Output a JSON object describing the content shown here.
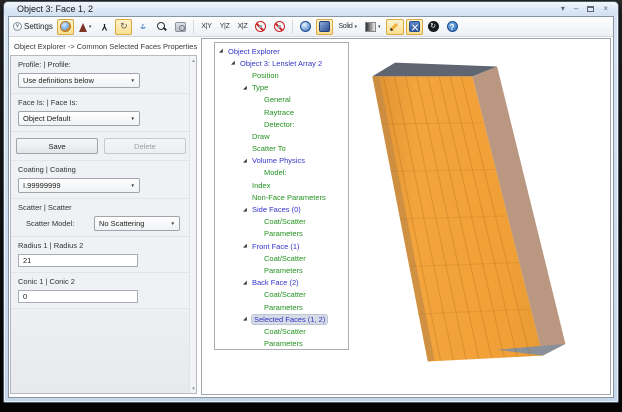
{
  "window": {
    "title": "Object 3: Face 1, 2"
  },
  "glyphs": {
    "settings_chevron": "∨",
    "window_menu": "▾",
    "minimize": "–",
    "close": "×",
    "dropdown_caret": "▾",
    "combo_arrow": "▼",
    "scroll_up": "▲",
    "scroll_down": "▼",
    "tree_expanded": "◢",
    "rotate": "↻",
    "reset": "↻",
    "axes": "Y",
    "pan_h": "↔",
    "pan_v": "↕",
    "help": "?"
  },
  "toolbar": {
    "settings": {
      "label": "Settings"
    },
    "buttons": [
      {
        "name": "shaded-model",
        "icon": "sphere-orange",
        "toggled": true
      },
      {
        "name": "view-orientation",
        "icon": "isometric-tree",
        "dropdown": true
      },
      {
        "name": "axes",
        "icon": "axes"
      },
      {
        "name": "rotate",
        "icon": "rotate-arrow",
        "toggled": true
      },
      {
        "name": "pan",
        "icon": "pan-arrows"
      },
      {
        "name": "zoom",
        "icon": "magnifier"
      },
      {
        "name": "zoom-window",
        "icon": "camera-frame"
      },
      {
        "type": "sep"
      },
      {
        "name": "view-xy",
        "label": "X|Y"
      },
      {
        "name": "view-yz",
        "label": "Y|Z"
      },
      {
        "name": "view-xz",
        "label": "X|Z"
      },
      {
        "name": "no-spin-1",
        "icon": "prohibit"
      },
      {
        "name": "no-spin-2",
        "icon": "prohibit"
      },
      {
        "type": "sep"
      },
      {
        "name": "globe",
        "icon": "globe-blue"
      },
      {
        "name": "cube",
        "icon": "cube-blue",
        "toggled": true
      },
      {
        "name": "solid-mode",
        "label": "Solid",
        "dropdown": true
      },
      {
        "name": "opacity",
        "icon": "gradient-square",
        "dropdown": true
      },
      {
        "name": "pen",
        "icon": "pen",
        "toggled": true
      },
      {
        "name": "fit-window",
        "icon": "fit-arrows",
        "toggled": true
      },
      {
        "name": "reset-view",
        "icon": "reset-circle"
      },
      {
        "name": "help",
        "icon": "help-circle"
      }
    ]
  },
  "breadcrumb": "Object Explorer ->  Common Selected Faces Properties",
  "properties_panel": {
    "sections": [
      {
        "name": "profile",
        "label": "Profile: | Profile:",
        "control": {
          "kind": "combo",
          "value": "Use definitions below"
        }
      },
      {
        "name": "face-is",
        "label": "Face Is: | Face Is:",
        "control": {
          "kind": "combo",
          "value": "Object Default"
        }
      },
      {
        "name": "actions",
        "kind": "buttons",
        "buttons": [
          {
            "label": "Save",
            "enabled": true
          },
          {
            "label": "Delete",
            "enabled": false
          }
        ]
      },
      {
        "name": "coating",
        "label": "Coating | Coating",
        "control": {
          "kind": "combo",
          "value": "I.99999999"
        }
      },
      {
        "name": "scatter",
        "label": "Scatter | Scatter",
        "control": {
          "kind": "inline-combo",
          "inline_label": "Scatter Model:",
          "value": "No Scattering"
        }
      },
      {
        "name": "radius",
        "label": "Radius 1 | Radius 2",
        "control": {
          "kind": "input",
          "value": "21"
        }
      },
      {
        "name": "conic",
        "label": "Conic 1 | Conic 2",
        "control": {
          "kind": "input",
          "value": "0"
        }
      }
    ]
  },
  "tree": {
    "items": [
      {
        "label": "Object Explorer",
        "level": 0,
        "color": "blue",
        "expanded": true
      },
      {
        "label": "Object 3: Lenslet Array 2",
        "level": 1,
        "color": "blue",
        "expanded": true
      },
      {
        "label": "Position",
        "level": 2,
        "color": "green"
      },
      {
        "label": "Type",
        "level": 2,
        "color": "green",
        "expanded": true
      },
      {
        "label": "General",
        "level": 3,
        "color": "green"
      },
      {
        "label": "Raytrace",
        "level": 3,
        "color": "green"
      },
      {
        "label": "Detector:",
        "level": 3,
        "color": "green"
      },
      {
        "label": "Draw",
        "level": 2,
        "color": "green"
      },
      {
        "label": "Scatter To",
        "level": 2,
        "color": "green"
      },
      {
        "label": "Volume Physics",
        "level": 2,
        "color": "blue",
        "expanded": true
      },
      {
        "label": "Model:",
        "level": 3,
        "color": "green"
      },
      {
        "label": "Index",
        "level": 2,
        "color": "green"
      },
      {
        "label": "Non-Face Parameters",
        "level": 2,
        "color": "green"
      },
      {
        "label": "Side Faces (0)",
        "level": 2,
        "color": "blue",
        "expanded": true
      },
      {
        "label": "Coat/Scatter",
        "level": 3,
        "color": "green"
      },
      {
        "label": "Parameters",
        "level": 3,
        "color": "green"
      },
      {
        "label": "Front Face (1)",
        "level": 2,
        "color": "blue",
        "expanded": true
      },
      {
        "label": "Coat/Scatter",
        "level": 3,
        "color": "green"
      },
      {
        "label": "Parameters",
        "level": 3,
        "color": "green"
      },
      {
        "label": "Back Face (2)",
        "level": 2,
        "color": "blue",
        "expanded": true
      },
      {
        "label": "Coat/Scatter",
        "level": 3,
        "color": "green"
      },
      {
        "label": "Parameters",
        "level": 3,
        "color": "green"
      },
      {
        "label": "Selected Faces (1, 2)",
        "level": 2,
        "color": "blue",
        "expanded": true,
        "selected": true
      },
      {
        "label": "Coat/Scatter",
        "level": 3,
        "color": "green"
      },
      {
        "label": "Parameters",
        "level": 3,
        "color": "green"
      }
    ]
  },
  "viewport": {
    "object_name": "Lenslet Array 2",
    "columns": 9,
    "rows": 6,
    "colors": {
      "front": "#F2A238",
      "front_dark": "#DE9230",
      "side": "#B7937C",
      "top": "#5F6672",
      "corner": "#8A9098",
      "left_edge": "#C68B45",
      "rib": "rgba(146,84,13,0.20)",
      "row": "rgba(146,84,13,0.13)"
    }
  },
  "colors": {
    "tree_blue": "#3434C8",
    "tree_green": "#22911F",
    "toggle_bg": "#FBDF92",
    "toggle_border": "#D9A83F",
    "selection_bg": "#D6DCE5"
  }
}
